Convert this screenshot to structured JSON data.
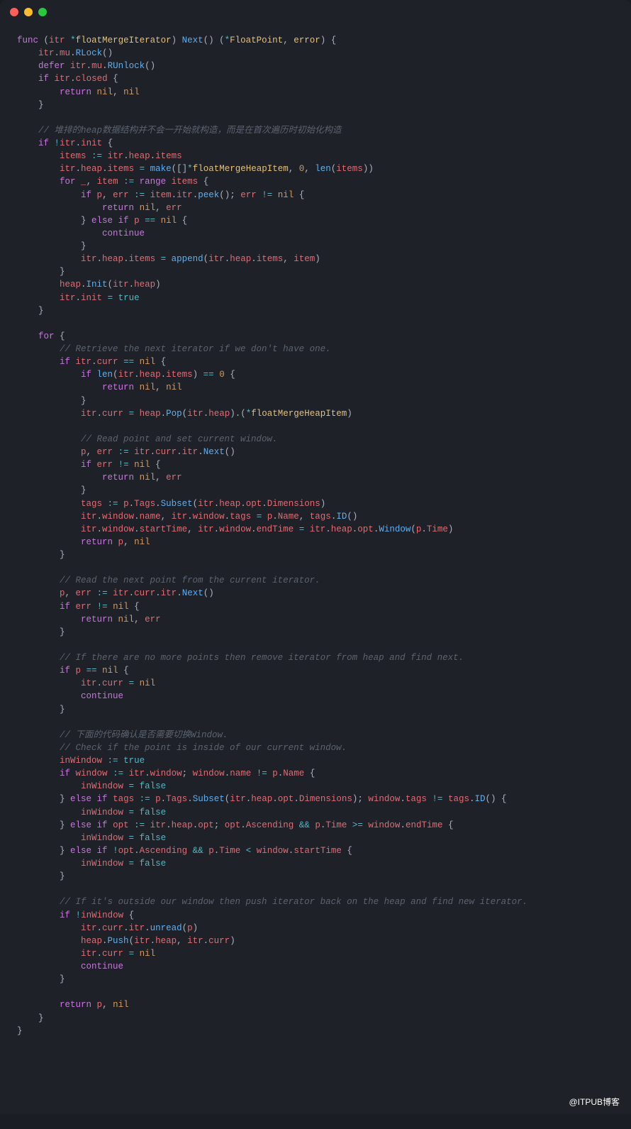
{
  "watermark": "@ITPUB博客",
  "code": {
    "l01": "func (itr *floatMergeIterator) Next() (*FloatPoint, error) {",
    "l02": "    itr.mu.RLock()",
    "l03": "    defer itr.mu.RUnlock()",
    "l04": "    if itr.closed {",
    "l05": "        return nil, nil",
    "l06": "    }",
    "l07": "",
    "l08": "    // 堆排的heap数据结构并不会一开始就构造，而是在首次遍历时初始化构造",
    "l09": "    if !itr.init {",
    "l10": "        items := itr.heap.items",
    "l11": "        itr.heap.items = make([]*floatMergeHeapItem, 0, len(items))",
    "l12": "        for _, item := range items {",
    "l13": "            if p, err := item.itr.peek(); err != nil {",
    "l14": "                return nil, err",
    "l15": "            } else if p == nil {",
    "l16": "                continue",
    "l17": "            }",
    "l18": "            itr.heap.items = append(itr.heap.items, item)",
    "l19": "        }",
    "l20": "        heap.Init(itr.heap)",
    "l21": "        itr.init = true",
    "l22": "    }",
    "l23": "",
    "l24": "    for {",
    "l25": "        // Retrieve the next iterator if we don't have one.",
    "l26": "        if itr.curr == nil {",
    "l27": "            if len(itr.heap.items) == 0 {",
    "l28": "                return nil, nil",
    "l29": "            }",
    "l30": "            itr.curr = heap.Pop(itr.heap).(*floatMergeHeapItem)",
    "l31": "",
    "l32": "            // Read point and set current window.",
    "l33": "            p, err := itr.curr.itr.Next()",
    "l34": "            if err != nil {",
    "l35": "                return nil, err",
    "l36": "            }",
    "l37": "            tags := p.Tags.Subset(itr.heap.opt.Dimensions)",
    "l38": "            itr.window.name, itr.window.tags = p.Name, tags.ID()",
    "l39": "            itr.window.startTime, itr.window.endTime = itr.heap.opt.Window(p.Time)",
    "l40": "            return p, nil",
    "l41": "        }",
    "l42": "",
    "l43": "        // Read the next point from the current iterator.",
    "l44": "        p, err := itr.curr.itr.Next()",
    "l45": "        if err != nil {",
    "l46": "            return nil, err",
    "l47": "        }",
    "l48": "",
    "l49": "        // If there are no more points then remove iterator from heap and find next.",
    "l50": "        if p == nil {",
    "l51": "            itr.curr = nil",
    "l52": "            continue",
    "l53": "        }",
    "l54": "",
    "l55": "        // 下面的代码确认是否需要切换Window.",
    "l56": "        // Check if the point is inside of our current window.",
    "l57": "        inWindow := true",
    "l58": "        if window := itr.window; window.name != p.Name {",
    "l59": "            inWindow = false",
    "l60": "        } else if tags := p.Tags.Subset(itr.heap.opt.Dimensions); window.tags != tags.ID() {",
    "l61": "            inWindow = false",
    "l62": "        } else if opt := itr.heap.opt; opt.Ascending && p.Time >= window.endTime {",
    "l63": "            inWindow = false",
    "l64": "        } else if !opt.Ascending && p.Time < window.startTime {",
    "l65": "            inWindow = false",
    "l66": "        }",
    "l67": "",
    "l68": "        // If it's outside our window then push iterator back on the heap and find new iterator.",
    "l69": "        if !inWindow {",
    "l70": "            itr.curr.itr.unread(p)",
    "l71": "            heap.Push(itr.heap, itr.curr)",
    "l72": "            itr.curr = nil",
    "l73": "            continue",
    "l74": "        }",
    "l75": "",
    "l76": "        return p, nil",
    "l77": "    }",
    "l78": "}"
  }
}
